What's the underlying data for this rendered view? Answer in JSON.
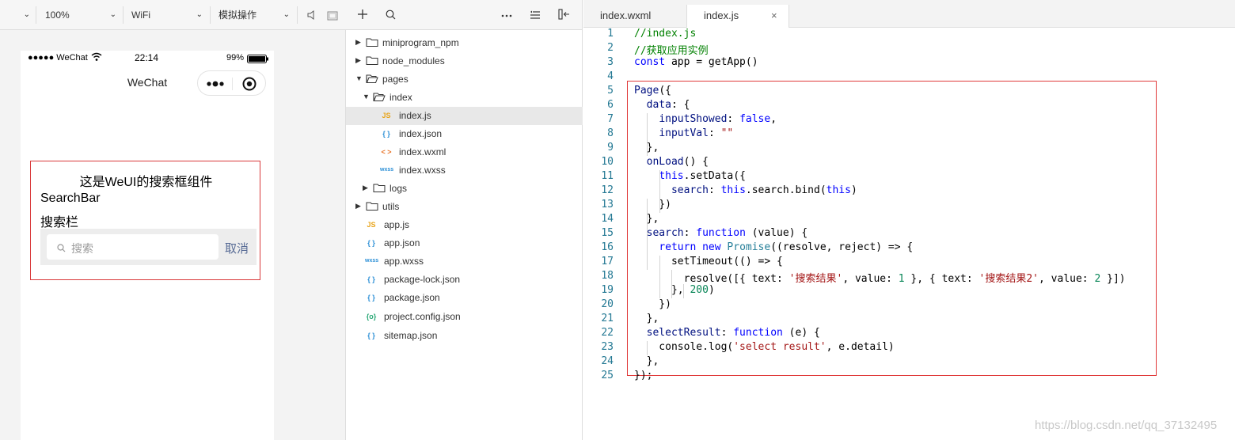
{
  "toolbar": {
    "dropdowns": [
      {
        "value": ""
      },
      {
        "value": "100%"
      },
      {
        "value": "WiFi"
      },
      {
        "value": "模拟操作"
      }
    ],
    "icons": [
      "volume-icon",
      "window-icon"
    ]
  },
  "simulator": {
    "status": {
      "signal": "●●●●● WeChat",
      "time": "22:14",
      "battery": "99%"
    },
    "nav_title": "WeChat",
    "demo": {
      "title": "这是WeUI的搜索框组件",
      "subtitle1": "SearchBar",
      "subtitle2": "搜索栏",
      "search_placeholder": "搜索",
      "cancel_label": "取消"
    }
  },
  "explorer": {
    "items": [
      {
        "label": "miniprogram_npm",
        "type": "folder",
        "depth": 0,
        "expanded": false
      },
      {
        "label": "node_modules",
        "type": "folder",
        "depth": 0,
        "expanded": false
      },
      {
        "label": "pages",
        "type": "folder",
        "depth": 0,
        "expanded": true
      },
      {
        "label": "index",
        "type": "folder",
        "depth": 1,
        "expanded": true
      },
      {
        "label": "index.js",
        "type": "js",
        "depth": 2,
        "selected": true
      },
      {
        "label": "index.json",
        "type": "json",
        "depth": 2
      },
      {
        "label": "index.wxml",
        "type": "wxml",
        "depth": 2
      },
      {
        "label": "index.wxss",
        "type": "wxss",
        "depth": 2
      },
      {
        "label": "logs",
        "type": "folder",
        "depth": 1,
        "expanded": false
      },
      {
        "label": "utils",
        "type": "folder",
        "depth": 0,
        "expanded": false
      },
      {
        "label": "app.js",
        "type": "js",
        "depth": 0
      },
      {
        "label": "app.json",
        "type": "json",
        "depth": 0
      },
      {
        "label": "app.wxss",
        "type": "wxss",
        "depth": 0
      },
      {
        "label": "package-lock.json",
        "type": "json",
        "depth": 0
      },
      {
        "label": "package.json",
        "type": "json",
        "depth": 0
      },
      {
        "label": "project.config.json",
        "type": "config",
        "depth": 0
      },
      {
        "label": "sitemap.json",
        "type": "json",
        "depth": 0
      }
    ]
  },
  "editor": {
    "tabs": [
      {
        "label": "index.wxml",
        "active": false
      },
      {
        "label": "index.js",
        "active": true,
        "close": "×"
      }
    ],
    "lines": [
      [
        [
          "c-com",
          "//index.js"
        ]
      ],
      [
        [
          "c-com",
          "//获取应用实例"
        ]
      ],
      [
        [
          "c-kw",
          "const"
        ],
        [
          "",
          " app = getApp()"
        ]
      ],
      [
        [
          "",
          ""
        ]
      ],
      [
        [
          "c-var",
          "Page"
        ],
        [
          "",
          "({"
        ]
      ],
      [
        [
          "",
          "  "
        ],
        [
          "c-var",
          "data"
        ],
        [
          "",
          ": {"
        ]
      ],
      [
        [
          "",
          "    "
        ],
        [
          "c-var",
          "inputShowed"
        ],
        [
          "",
          ": "
        ],
        [
          "c-kw",
          "false"
        ],
        [
          "",
          ","
        ]
      ],
      [
        [
          "",
          "    "
        ],
        [
          "c-var",
          "inputVal"
        ],
        [
          "",
          ": "
        ],
        [
          "c-str",
          "\"\""
        ]
      ],
      [
        [
          "",
          "  },"
        ]
      ],
      [
        [
          "",
          "  "
        ],
        [
          "c-var",
          "onLoad"
        ],
        [
          "",
          "() {"
        ]
      ],
      [
        [
          "",
          "    "
        ],
        [
          "c-kw",
          "this"
        ],
        [
          "",
          ".setData({"
        ]
      ],
      [
        [
          "",
          "      "
        ],
        [
          "c-var",
          "search"
        ],
        [
          "",
          ": "
        ],
        [
          "c-kw",
          "this"
        ],
        [
          "",
          ".search.bind("
        ],
        [
          "c-kw",
          "this"
        ],
        [
          "",
          ")"
        ]
      ],
      [
        [
          "",
          "    })"
        ]
      ],
      [
        [
          "",
          "  },"
        ]
      ],
      [
        [
          "",
          "  "
        ],
        [
          "c-var",
          "search"
        ],
        [
          "",
          ": "
        ],
        [
          "c-kw",
          "function"
        ],
        [
          "",
          " (value) {"
        ]
      ],
      [
        [
          "",
          "    "
        ],
        [
          "c-kw",
          "return"
        ],
        [
          "",
          " "
        ],
        [
          "c-kw",
          "new"
        ],
        [
          "",
          " "
        ],
        [
          "c-cls",
          "Promise"
        ],
        [
          "",
          "((resolve, reject) => {"
        ]
      ],
      [
        [
          "",
          "      setTimeout(() => {"
        ]
      ],
      [
        [
          "",
          "        resolve([{ text: "
        ],
        [
          "c-str",
          "'搜索结果'"
        ],
        [
          "",
          ", value: "
        ],
        [
          "c-num",
          "1"
        ],
        [
          "",
          " }, { text: "
        ],
        [
          "c-str",
          "'搜索结果2'"
        ],
        [
          "",
          ", value: "
        ],
        [
          "c-num",
          "2"
        ],
        [
          "",
          " }])"
        ]
      ],
      [
        [
          "",
          "      }, "
        ],
        [
          "c-num",
          "200"
        ],
        [
          "",
          ")"
        ]
      ],
      [
        [
          "",
          "    })"
        ]
      ],
      [
        [
          "",
          "  },"
        ]
      ],
      [
        [
          "",
          "  "
        ],
        [
          "c-var",
          "selectResult"
        ],
        [
          "",
          ": "
        ],
        [
          "c-kw",
          "function"
        ],
        [
          "",
          " (e) {"
        ]
      ],
      [
        [
          "",
          "    console.log("
        ],
        [
          "c-str",
          "'select result'"
        ],
        [
          "",
          ", e.detail)"
        ]
      ],
      [
        [
          "",
          "  },"
        ]
      ],
      [
        [
          "",
          "});"
        ]
      ]
    ]
  },
  "watermark": "https://blog.csdn.net/qq_37132495"
}
